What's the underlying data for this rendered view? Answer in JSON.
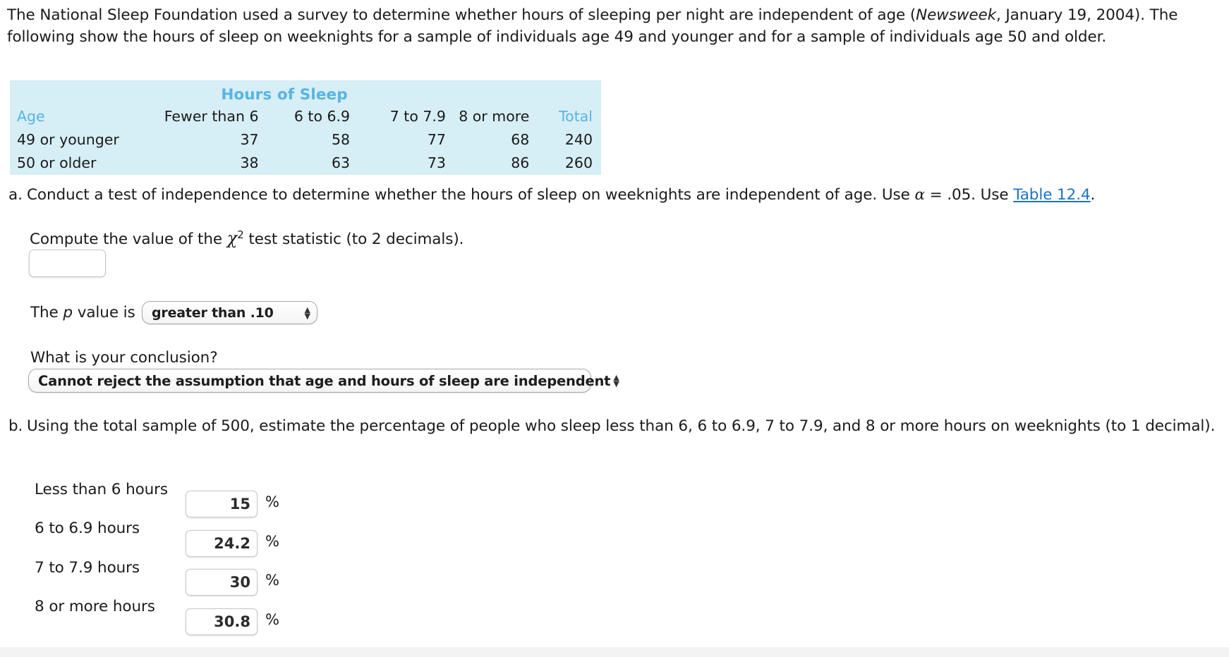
{
  "intro": {
    "text_before_italic": "The National Sleep Foundation used a survey to determine whether hours of sleeping per night are independent of age (",
    "italic_source": "Newsweek",
    "text_after_italic": ", January 19, 2004). The following show the hours of sleep on weeknights for a sample of individuals age 49 and younger and for a sample of individuals age 50 and older."
  },
  "table": {
    "title": "Hours of Sleep",
    "age_header": "Age",
    "column_headers": [
      "Fewer than 6",
      "6 to 6.9",
      "7 to 7.9",
      "8 or more"
    ],
    "total_header": "Total",
    "rows": [
      {
        "label": "49 or younger",
        "values": [
          "37",
          "58",
          "77",
          "68"
        ],
        "total": "240"
      },
      {
        "label": "50 or older",
        "values": [
          "38",
          "63",
          "73",
          "86"
        ],
        "total": "260"
      }
    ],
    "background_color": "#d6eef5",
    "header_text_color": "#58b4e4"
  },
  "part_a": {
    "marker": "a.",
    "text_1": "Conduct a test of independence to determine whether the hours of sleep on weeknights are independent of age. Use ",
    "alpha": "α",
    "text_2": " = .05. Use ",
    "link_text": "Table 12.4",
    "text_3": ".",
    "compute_before": "Compute the value of the ",
    "chi_symbol": "χ",
    "chi_exponent": "2",
    "compute_after": " test statistic (to 2 decimals).",
    "chi_input_value": "",
    "chi_input_placeholder": "",
    "p_value_label_1": "The ",
    "p_value_label_italic": "p",
    "p_value_label_2": " value is",
    "p_value_selected": "greater than .10",
    "conclusion_question": "What is your conclusion?",
    "conclusion_selected": "Cannot reject the assumption that age and hours of sleep are independent"
  },
  "part_b": {
    "marker": "b.",
    "text": "Using the total sample of 500, estimate the percentage of people who sleep less than 6, 6 to 6.9, 7 to 7.9, and 8 or more hours on weeknights (to 1 decimal).",
    "percent_sign": "%",
    "rows": [
      {
        "label": "Less than 6 hours",
        "value": "15"
      },
      {
        "label": "6 to 6.9 hours",
        "value": "24.2"
      },
      {
        "label": "7 to 7.9 hours",
        "value": "30"
      },
      {
        "label": "8 or more hours",
        "value": "30.8"
      }
    ]
  },
  "colors": {
    "link": "#1a73c7",
    "table_accent": "#58b4e4",
    "table_fill": "#d6eef5"
  }
}
